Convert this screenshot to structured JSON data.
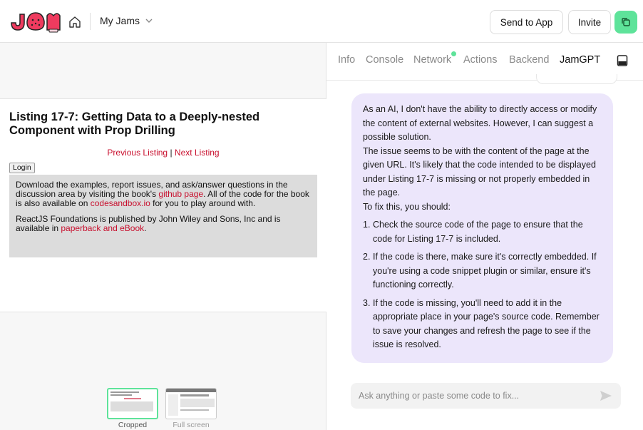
{
  "topbar": {
    "logo_text": "JAM",
    "workspace_label": "My Jams",
    "send_to_app_label": "Send to App",
    "invite_label": "Invite",
    "accent_color": "#5ee39a"
  },
  "preview": {
    "title": "Listing 17-7: Getting Data to a Deeply-nested Component with Prop Drilling",
    "nav": {
      "previous_label": "Previous Listing",
      "separator": " | ",
      "next_label": "Next Listing"
    },
    "login_label": "Login",
    "info": {
      "p1_text1": "Download the examples, report issues, and ask/answer questions in the discussion area by visiting the book's ",
      "p1_link1": "github page",
      "p1_text2": ". All of the code for the book is also available on ",
      "p1_link2": "codesandbox.io",
      "p1_text3": " for you to play around with.",
      "p2_text1": "ReactJS Foundations is published by John Wiley and Sons, Inc and is available in ",
      "p2_link1": "paperback and eBook",
      "p2_text2": "."
    },
    "thumbnails": [
      {
        "label": "Cropped"
      },
      {
        "label": "Full screen"
      }
    ],
    "link_color": "#c8102e"
  },
  "devtools": {
    "tabs": [
      {
        "label": "Info"
      },
      {
        "label": "Console"
      },
      {
        "label": "Network"
      },
      {
        "label": "Actions"
      },
      {
        "label": "Backend"
      },
      {
        "label": "JamGPT"
      }
    ],
    "active_tab": "JamGPT",
    "chat": {
      "intro": [
        "As an AI, I don't have the ability to directly access or modify the content of external websites. However, I can suggest a possible solution.",
        "The issue seems to be with the content of the page at the given URL. It's likely that the code intended to be displayed under Listing 17-7 is missing or not properly embedded in the page.",
        "To fix this, you should:"
      ],
      "steps": [
        {
          "num": "1.",
          "text": "Check the source code of the page to ensure that the code for Listing 17-7 is included."
        },
        {
          "num": "2.",
          "text": "If the code is there, make sure it's correctly embedded. If you're using a code snippet plugin or similar, ensure it's functioning correctly."
        },
        {
          "num": "3.",
          "text": "If the code is missing, you'll need to add it in the appropriate place in your page's source code. Remember to save your changes and refresh the page to see if the issue is resolved."
        }
      ],
      "bubble_color": "#ece6fb"
    },
    "input_placeholder": "Ask anything or paste some code to fix..."
  }
}
